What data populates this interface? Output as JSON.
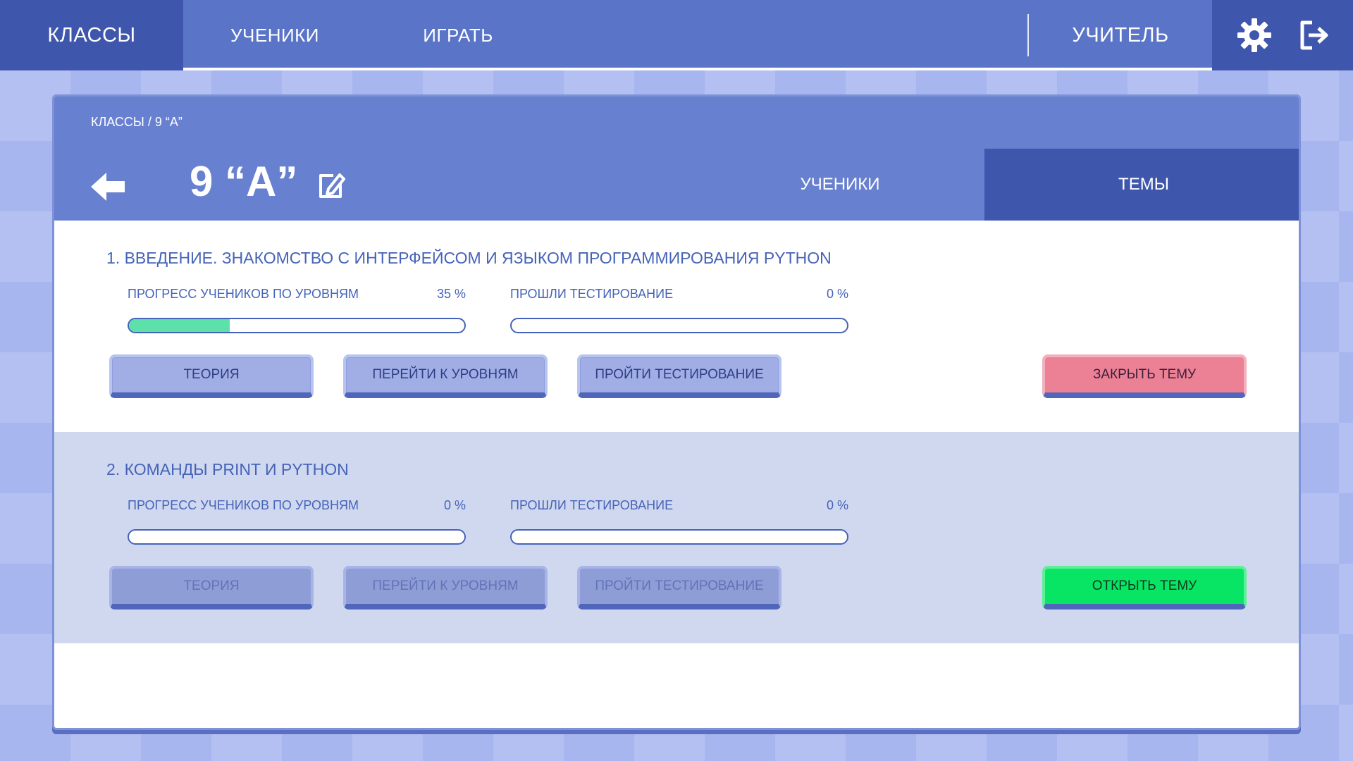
{
  "nav": {
    "classes": "КЛАССЫ",
    "students": "УЧЕНИКИ",
    "play": "ИГРАТЬ",
    "user": "УЧИТЕЛЬ",
    "settings_icon": "gear-icon",
    "logout_icon": "logout-icon"
  },
  "panel": {
    "breadcrumb": "КЛАССЫ / 9 “А”",
    "back_icon": "arrow-left-icon",
    "class_name": "9 “А”",
    "edit_icon": "edit-icon",
    "tabs": [
      {
        "label": "УЧЕНИКИ",
        "active": false
      },
      {
        "label": "ТЕМЫ",
        "active": true
      }
    ]
  },
  "topics": [
    {
      "title": "1. ВВЕДЕНИЕ. ЗНАКОМСТВО С ИНТЕРФЕЙСОМ И ЯЗЫКОМ ПРОГРАММИРОВАНИЯ PYTHON",
      "progress_label": "ПРОГРЕСС УЧЕНИКОВ ПО УРОВНЯМ",
      "progress_value": "35 %",
      "progress_fraction": 0.3,
      "test_label": "ПРОШЛИ ТЕСТИРОВАНИЕ",
      "test_value": "0 %",
      "test_fraction": 0,
      "buttons": [
        "ТЕОРИЯ",
        "ПЕРЕЙТИ К УРОВНЯМ",
        "ПРОЙТИ ТЕСТИРОВАНИЕ"
      ],
      "action": "ЗАКРЫТЬ ТЕМУ",
      "enabled": true
    },
    {
      "title": "2. КОМАНДЫ PRINT И PYTHON",
      "progress_label": "ПРОГРЕСС УЧЕНИКОВ ПО УРОВНЯМ",
      "progress_value": "0 %",
      "progress_fraction": 0,
      "test_label": "ПРОШЛИ ТЕСТИРОВАНИЕ",
      "test_value": "0 %",
      "test_fraction": 0,
      "buttons": [
        "ТЕОРИЯ",
        "ПЕРЕЙТИ К УРОВНЯМ",
        "ПРОЙТИ ТЕСТИРОВАНИЕ"
      ],
      "action": "ОТКРЫТЬ ТЕМУ",
      "enabled": false
    }
  ],
  "colors": {
    "nav_bg": "#5a74c8",
    "nav_active": "#3f56ad",
    "header_bg": "#6880d0",
    "text_blue": "#4563b8",
    "progress_fill": "#5de0aa",
    "close_red": "#ec8095",
    "open_green": "#08e565"
  }
}
